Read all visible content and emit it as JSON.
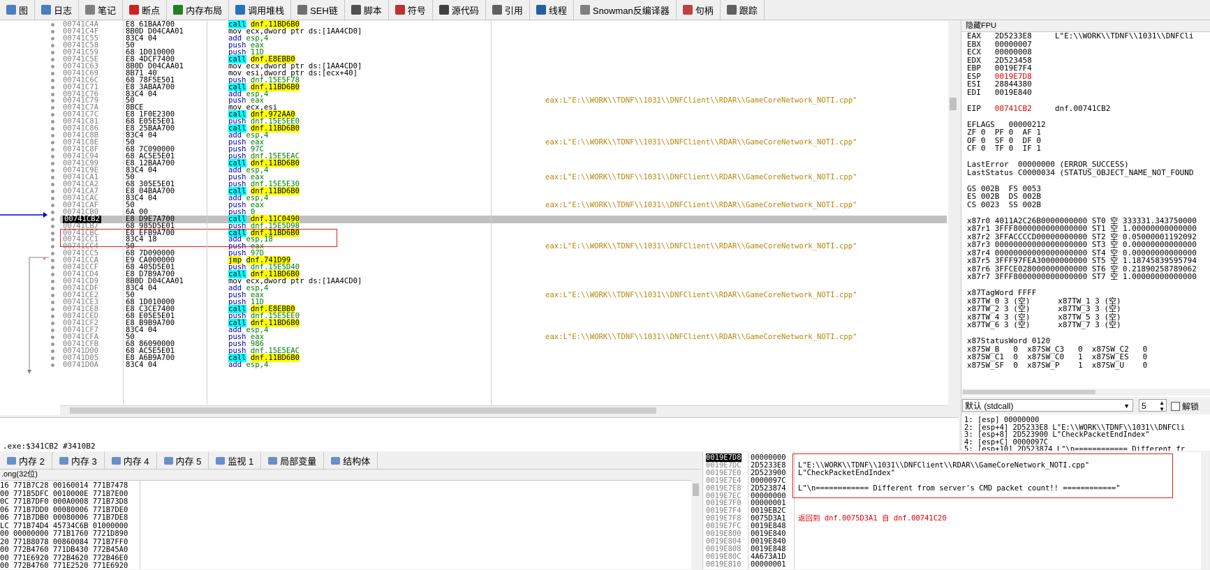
{
  "tabs": [
    {
      "label": "图",
      "icon": "cpu-icon",
      "color": "#4a7fc1"
    },
    {
      "label": "日志",
      "icon": "log-icon",
      "color": "#4a7fc1"
    },
    {
      "label": "笔记",
      "icon": "notes-icon",
      "color": "#808080"
    },
    {
      "label": "断点",
      "icon": "breakpoint-icon",
      "color": "#d02020"
    },
    {
      "label": "内存布局",
      "icon": "memory-map-icon",
      "color": "#208020"
    },
    {
      "label": "调用堆栈",
      "icon": "call-stack-icon",
      "color": "#2a70c0"
    },
    {
      "label": "SEH链",
      "icon": "seh-icon",
      "color": "#707070"
    },
    {
      "label": "脚本",
      "icon": "script-icon",
      "color": "#505050"
    },
    {
      "label": "符号",
      "icon": "symbols-icon",
      "color": "#c03030"
    },
    {
      "label": "源代码",
      "icon": "source-icon",
      "color": "#404040"
    },
    {
      "label": "引用",
      "icon": "references-icon",
      "color": "#606060"
    },
    {
      "label": "线程",
      "icon": "threads-icon",
      "color": "#2060a0"
    },
    {
      "label": "Snowman反编译器",
      "icon": "snowman-icon",
      "color": "#808080"
    },
    {
      "label": "句柄",
      "icon": "handles-icon",
      "color": "#c04040"
    },
    {
      "label": "跟踪",
      "icon": "trace-icon",
      "color": "#606060"
    }
  ],
  "disasm": [
    {
      "addr": "00741C4A",
      "bytes": "E8 61BAA700",
      "op": "call",
      "arg": "dnf.11BD6B0",
      "com": ""
    },
    {
      "addr": "00741C4F",
      "bytes": "8B0D D04CAA01",
      "op": "mov",
      "arg": "ecx,dword ptr ds:[1AA4CD0]",
      "com": ""
    },
    {
      "addr": "00741C55",
      "bytes": "83C4 04",
      "op": "add",
      "arg": "esp,4",
      "com": ""
    },
    {
      "addr": "00741C58",
      "bytes": "50",
      "op": "push",
      "arg": "eax",
      "com": ""
    },
    {
      "addr": "00741C59",
      "bytes": "68 1D010000",
      "op": "push",
      "arg": "11D",
      "com": ""
    },
    {
      "addr": "00741C5E",
      "bytes": "E8 4DCF7400",
      "op": "call",
      "arg": "dnf.E8EBB0",
      "com": ""
    },
    {
      "addr": "00741C63",
      "bytes": "8B0D D04CAA01",
      "op": "mov",
      "arg": "ecx,dword ptr ds:[1AA4CD0]",
      "com": ""
    },
    {
      "addr": "00741C69",
      "bytes": "8B71 40",
      "op": "mov",
      "arg": "esi,dword ptr ds:[ecx+40]",
      "com": ""
    },
    {
      "addr": "00741C6C",
      "bytes": "68 78F5E501",
      "op": "push",
      "arg": "dnf.15E5F78",
      "com": ""
    },
    {
      "addr": "00741C71",
      "bytes": "E8 3ABAA700",
      "op": "call",
      "arg": "dnf.11BD6B0",
      "com": ""
    },
    {
      "addr": "00741C76",
      "bytes": "83C4 04",
      "op": "add",
      "arg": "esp,4",
      "com": ""
    },
    {
      "addr": "00741C79",
      "bytes": "50",
      "op": "push",
      "arg": "eax",
      "com": "eax:L\"E:\\\\WORK\\\\TDNF\\\\1031\\\\DNFClient\\\\RDAR\\\\GameCoreNetwork_NOTI.cpp\""
    },
    {
      "addr": "00741C7A",
      "bytes": "8BCE",
      "op": "mov",
      "arg": "ecx,esi",
      "com": ""
    },
    {
      "addr": "00741C7C",
      "bytes": "E8 1F0E2300",
      "op": "call",
      "arg": "dnf.972AA0",
      "com": ""
    },
    {
      "addr": "00741C81",
      "bytes": "68 E05E5E01",
      "op": "push",
      "arg": "dnf.15E5EE0",
      "com": ""
    },
    {
      "addr": "00741C86",
      "bytes": "E8 25BAA700",
      "op": "call",
      "arg": "dnf.11BD6B0",
      "com": ""
    },
    {
      "addr": "00741C8B",
      "bytes": "83C4 04",
      "op": "add",
      "arg": "esp,4",
      "com": ""
    },
    {
      "addr": "00741C8E",
      "bytes": "50",
      "op": "push",
      "arg": "eax",
      "com": "eax:L\"E:\\\\WORK\\\\TDNF\\\\1031\\\\DNFClient\\\\RDAR\\\\GameCoreNetwork_NOTI.cpp\""
    },
    {
      "addr": "00741C8F",
      "bytes": "68 7C090000",
      "op": "push",
      "arg": "97C",
      "com": ""
    },
    {
      "addr": "00741C94",
      "bytes": "68 AC5E5E01",
      "op": "push",
      "arg": "dnf.15E5EAC",
      "com": ""
    },
    {
      "addr": "00741C99",
      "bytes": "E8 12BAA700",
      "op": "call",
      "arg": "dnf.11BD6B0",
      "com": ""
    },
    {
      "addr": "00741C9E",
      "bytes": "83C4 04",
      "op": "add",
      "arg": "esp,4",
      "com": ""
    },
    {
      "addr": "00741CA1",
      "bytes": "50",
      "op": "push",
      "arg": "eax",
      "com": "eax:L\"E:\\\\WORK\\\\TDNF\\\\1031\\\\DNFClient\\\\RDAR\\\\GameCoreNetwork_NOTI.cpp\""
    },
    {
      "addr": "00741CA2",
      "bytes": "68 305E5E01",
      "op": "push",
      "arg": "dnf.15E5E30",
      "com": ""
    },
    {
      "addr": "00741CA7",
      "bytes": "E8 04BAA700",
      "op": "call",
      "arg": "dnf.11BD6B0",
      "com": ""
    },
    {
      "addr": "00741CAC",
      "bytes": "83C4 04",
      "op": "add",
      "arg": "esp,4",
      "com": ""
    },
    {
      "addr": "00741CAF",
      "bytes": "50",
      "op": "push",
      "arg": "eax",
      "com": "eax:L\"E:\\\\WORK\\\\TDNF\\\\1031\\\\DNFClient\\\\RDAR\\\\GameCoreNetwork_NOTI.cpp\""
    },
    {
      "addr": "00741CB0",
      "bytes": "6A 00",
      "op": "push",
      "arg": "0",
      "com": ""
    },
    {
      "addr": "00741CB2",
      "bytes": "E8 D9E7A700",
      "op": "call",
      "arg": "dnf.11C0490",
      "com": "",
      "current": true
    },
    {
      "addr": "00741CB7",
      "bytes": "68 985D5E01",
      "op": "push",
      "arg": "dnf.15E5D98",
      "com": ""
    },
    {
      "addr": "00741CBC",
      "bytes": "E8 EFB9A700",
      "op": "call",
      "arg": "dnf.11BD6B0",
      "com": ""
    },
    {
      "addr": "00741CC1",
      "bytes": "83C4 18",
      "op": "add",
      "arg": "esp,18",
      "com": ""
    },
    {
      "addr": "00741CC4",
      "bytes": "50",
      "op": "push",
      "arg": "eax",
      "com": "eax:L\"E:\\\\WORK\\\\TDNF\\\\1031\\\\DNFClient\\\\RDAR\\\\GameCoreNetwork_NOTI.cpp\""
    },
    {
      "addr": "00741CC5",
      "bytes": "68 7D090000",
      "op": "push",
      "arg": "97D",
      "com": ""
    },
    {
      "addr": "00741CCA",
      "bytes": "E9 CA000000",
      "op": "jmp",
      "arg": "dnf.741D99",
      "com": ""
    },
    {
      "addr": "00741CCF",
      "bytes": "68 405D5E01",
      "op": "push",
      "arg": "dnf.15E5D40",
      "com": ""
    },
    {
      "addr": "00741CD4",
      "bytes": "E8 D7B9A700",
      "op": "call",
      "arg": "dnf.11BD6B0",
      "com": ""
    },
    {
      "addr": "00741CD9",
      "bytes": "8B0D D04CAA01",
      "op": "mov",
      "arg": "ecx,dword ptr ds:[1AA4CD0]",
      "com": ""
    },
    {
      "addr": "00741CDF",
      "bytes": "83C4 04",
      "op": "add",
      "arg": "esp,4",
      "com": ""
    },
    {
      "addr": "00741CE2",
      "bytes": "50",
      "op": "push",
      "arg": "eax",
      "com": "eax:L\"E:\\\\WORK\\\\TDNF\\\\1031\\\\DNFClient\\\\RDAR\\\\GameCoreNetwork_NOTI.cpp\""
    },
    {
      "addr": "00741CE3",
      "bytes": "68 1D010000",
      "op": "push",
      "arg": "11D",
      "com": ""
    },
    {
      "addr": "00741CE8",
      "bytes": "E8 C3CE7400",
      "op": "call",
      "arg": "dnf.E8EBB0",
      "com": ""
    },
    {
      "addr": "00741CED",
      "bytes": "68 E05E5E01",
      "op": "push",
      "arg": "dnf.15E5EE0",
      "com": ""
    },
    {
      "addr": "00741CF2",
      "bytes": "E8 B9B9A700",
      "op": "call",
      "arg": "dnf.11BD6B0",
      "com": ""
    },
    {
      "addr": "00741CF7",
      "bytes": "83C4 04",
      "op": "add",
      "arg": "esp,4",
      "com": ""
    },
    {
      "addr": "00741CFA",
      "bytes": "50",
      "op": "push",
      "arg": "eax",
      "com": "eax:L\"E:\\\\WORK\\\\TDNF\\\\1031\\\\DNFClient\\\\RDAR\\\\GameCoreNetwork_NOTI.cpp\""
    },
    {
      "addr": "00741CFB",
      "bytes": "68 86090000",
      "op": "push",
      "arg": "986",
      "com": ""
    },
    {
      "addr": "00741D00",
      "bytes": "68 AC5E5E01",
      "op": "push",
      "arg": "dnf.15E5EAC",
      "com": ""
    },
    {
      "addr": "00741D05",
      "bytes": "E8 A6B9A700",
      "op": "call",
      "arg": "dnf.11BD6B0",
      "com": ""
    },
    {
      "addr": "00741D0A",
      "bytes": "83C4 04",
      "op": "add",
      "arg": "esp,4",
      "com": ""
    }
  ],
  "info_text": ".exe:$341CB2 #3410B2",
  "regs": {
    "header": "隐藏FPU",
    "lines": [
      {
        "t": "EAX   2D5233E8     L\"E:\\\\WORK\\\\TDNF\\\\1031\\\\DNFCli"
      },
      {
        "t": "EBX   00000007"
      },
      {
        "t": "ECX   00000008"
      },
      {
        "t": "EDX   2D523458"
      },
      {
        "t": "EBP   0019E7F4"
      },
      {
        "t": "ESP   ",
        "chg": "0019E7D8"
      },
      {
        "t": "ESI   28844380"
      },
      {
        "t": "EDI   0019E840"
      },
      {
        "t": ""
      },
      {
        "t": "EIP   ",
        "chg": "00741CB2",
        "tail": "     dnf.00741CB2"
      },
      {
        "t": ""
      },
      {
        "t": "EFLAGS   00000212"
      },
      {
        "t": "ZF 0  PF 0  AF 1"
      },
      {
        "t": "OF 0  SF 0  DF 0"
      },
      {
        "t": "CF 0  TF 0  IF 1"
      },
      {
        "t": ""
      },
      {
        "t": "LastError  00000000 (ERROR_SUCCESS)"
      },
      {
        "t": "LastStatus C0000034 (STATUS_OBJECT_NAME_NOT_FOUND"
      },
      {
        "t": ""
      },
      {
        "t": "GS 002B  FS 0053"
      },
      {
        "t": "ES 002B  DS 002B"
      },
      {
        "t": "CS 0023  SS 002B"
      },
      {
        "t": ""
      },
      {
        "t": "x87r0 4011A2C26B0000000000 ST0 空 333331.343750000"
      },
      {
        "t": "x87r1 3FFF8000000000000000 ST1 空 1.00000000000000"
      },
      {
        "t": "x87r2 3FFACCCCD00000000000 ST2 空 0.05000001192092"
      },
      {
        "t": "x87r3 00000000000000000000 ST3 空 0.00000000000000"
      },
      {
        "t": "x87r4 00000000000000000000 ST4 空 0.00000000000000"
      },
      {
        "t": "x87r5 3FFF97FEA30000000000 ST5 空 1.18745839595794"
      },
      {
        "t": "x87r6 3FFCE028000000000000 ST6 空 0.21890258789062"
      },
      {
        "t": "x87r7 3FFF8000000000000000 ST7 空 1.00000000000000"
      },
      {
        "t": ""
      },
      {
        "t": "x87TagWord FFFF"
      },
      {
        "t": "x87TW_0 3 (空)      x87TW_1 3 (空)"
      },
      {
        "t": "x87TW_2 3 (空)      x87TW_3 3 (空)"
      },
      {
        "t": "x87TW_4 3 (空)      x87TW_5 3 (空)"
      },
      {
        "t": "x87TW_6 3 (空)      x87TW_7 3 (空)"
      },
      {
        "t": ""
      },
      {
        "t": "x87StatusWord 0120"
      },
      {
        "t": "x87SW_B   0  x87SW_C3   0  x87SW_C2   0"
      },
      {
        "t": "x87SW_C1  0  x87SW_C0   1  x87SW_ES   0"
      },
      {
        "t": "x87SW_SF  0  x87SW_P    1  x87SW_U    0"
      }
    ]
  },
  "callconv": {
    "select": "默认 (stdcall)",
    "count": "5",
    "lock_label": "解锁"
  },
  "args": [
    "1: [esp] 00000000",
    "2: [esp+4] 2D5233E8 L\"E:\\\\WORK\\\\TDNF\\\\1031\\\\DNFCli",
    "3: [esp+8] 2D523900 L\"CheckPacketEndIndex\"",
    "4: [esp+C] 0000097C",
    "5: [esp+10] 2D523874 L\"\\n============ Different fr"
  ],
  "btabs": [
    {
      "label": "内存 2",
      "icon": "memory-icon"
    },
    {
      "label": "内存 3",
      "icon": "memory-icon"
    },
    {
      "label": "内存 4",
      "icon": "memory-icon"
    },
    {
      "label": "内存 5",
      "icon": "memory-icon"
    },
    {
      "label": "监视 1",
      "icon": "watch-icon"
    },
    {
      "label": "局部变量",
      "icon": "locals-icon"
    },
    {
      "label": "结构体",
      "icon": "struct-icon"
    }
  ],
  "dump": {
    "header": ".ong(32位)",
    "lines": [
      "16 771B7C28 00160014 771B7478",
      "00 771B5DFC 0010000E 771B7E00",
      "0C 771B7DF0 000A0008 771B73D8",
      "06 771B7DD0 00080006 771B7DE0",
      "06 771B7DB0 00080006 771B7DE8",
      "LC 771B74D4 45734C6B 01000000",
      "00 00000000 771B1760 7721D890",
      "20 771B8078 00860084 771B7FF0",
      "00 772B4760 771DB430 772B45A0",
      "00 771E6920 772B4620 772B46E0",
      "00 772B4760 771E2520 771E6920"
    ]
  },
  "stack": [
    {
      "addr": "0019E7D8",
      "val": "00000000",
      "com": "",
      "top": true
    },
    {
      "addr": "0019E7DC",
      "val": "2D5233E8",
      "com": "L\"E:\\\\WORK\\\\TDNF\\\\1031\\\\DNFClient\\\\RDAR\\\\GameCoreNetwork_NOTI.cpp\""
    },
    {
      "addr": "0019E7E0",
      "val": "2D523900",
      "com": "L\"CheckPacketEndIndex\""
    },
    {
      "addr": "0019E7E4",
      "val": "0000097C",
      "com": ""
    },
    {
      "addr": "0019E7E8",
      "val": "2D523874",
      "com": "L\"\\n============ Different from server's CMD packet count!! ============\""
    },
    {
      "addr": "0019E7EC",
      "val": "00000000",
      "com": ""
    },
    {
      "addr": "0019E7F0",
      "val": "00000001",
      "com": ""
    },
    {
      "addr": "0019E7F4",
      "val": "0019EB2C",
      "com": ""
    },
    {
      "addr": "0019E7F8",
      "val": "0075D3A1",
      "com": "返回到 dnf.0075D3A1 自 dnf.00741C20",
      "ret": true
    },
    {
      "addr": "0019E7FC",
      "val": "0019E848",
      "com": ""
    },
    {
      "addr": "0019E800",
      "val": "0019E840",
      "com": ""
    },
    {
      "addr": "0019E804",
      "val": "0019E840",
      "com": ""
    },
    {
      "addr": "0019E808",
      "val": "0019E848",
      "com": ""
    },
    {
      "addr": "0019E80C",
      "val": "4A673A1D",
      "com": ""
    },
    {
      "addr": "0019E810",
      "val": "00000001",
      "com": ""
    }
  ]
}
